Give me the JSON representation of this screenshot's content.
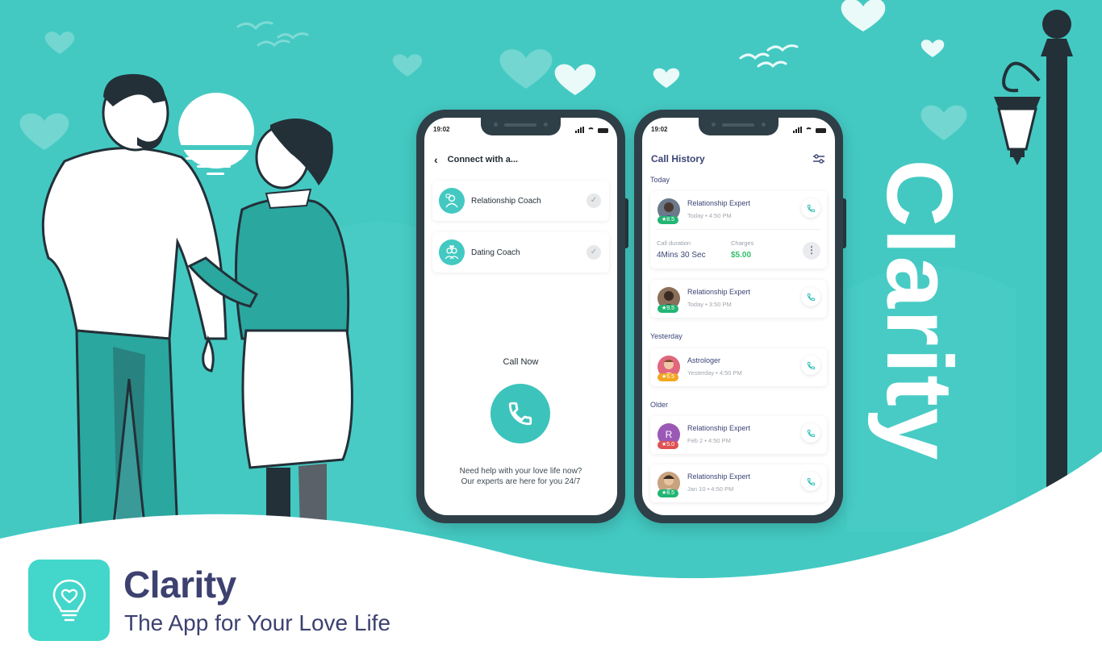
{
  "brand": {
    "name": "Clarity",
    "tagline": "The App for Your Love Life",
    "vertical_title": "Clarity",
    "colors": {
      "teal": "#43c9c2",
      "navy": "#3c4170",
      "green": "#2fbf6a"
    }
  },
  "phone1": {
    "status_time": "19:02",
    "header": "Connect with a...",
    "options": [
      {
        "label": "Relationship Coach",
        "icon": "coach-icon"
      },
      {
        "label": "Dating Coach",
        "icon": "dating-icon"
      }
    ],
    "call_now": "Call Now",
    "help_line1": "Need help with your love life now?",
    "help_line2": "Our experts are here for you 24/7"
  },
  "phone2": {
    "status_time": "19:02",
    "title": "Call History",
    "sections": {
      "today": "Today",
      "yesterday": "Yesterday",
      "older": "Older"
    },
    "calls": [
      {
        "name": "Relationship Expert",
        "meta": "Today  •  4:50 PM",
        "rating": "8.5",
        "rating_color": "#22b573",
        "avatar_bg": "#6b7a8a"
      },
      {
        "name": "Relationship Expert",
        "meta": "Today  •  3:50 PM",
        "rating": "9.5",
        "rating_color": "#22b573",
        "avatar_bg": "#8a6f5a"
      },
      {
        "name": "Astrologer",
        "meta": "Yesterday  •  4:50 PM",
        "rating": "6.5",
        "rating_color": "#f2a61f",
        "avatar_bg": "#e0677d"
      },
      {
        "name": "Relationship Expert",
        "meta": "Feb 2  •  4:50 PM",
        "rating": "5.0",
        "rating_color": "#e05252",
        "avatar_bg": "#9b59b6",
        "initial": "R"
      },
      {
        "name": "Relationship Expert",
        "meta": "Jan 10  •  4:50 PM",
        "rating": "8.5",
        "rating_color": "#22b573",
        "avatar_bg": "#c9a27e"
      }
    ],
    "detail": {
      "duration_label": "Call duration",
      "duration_value": "4Mins 30 Sec",
      "charges_label": "Charges",
      "charges_value": "$5.00"
    }
  }
}
